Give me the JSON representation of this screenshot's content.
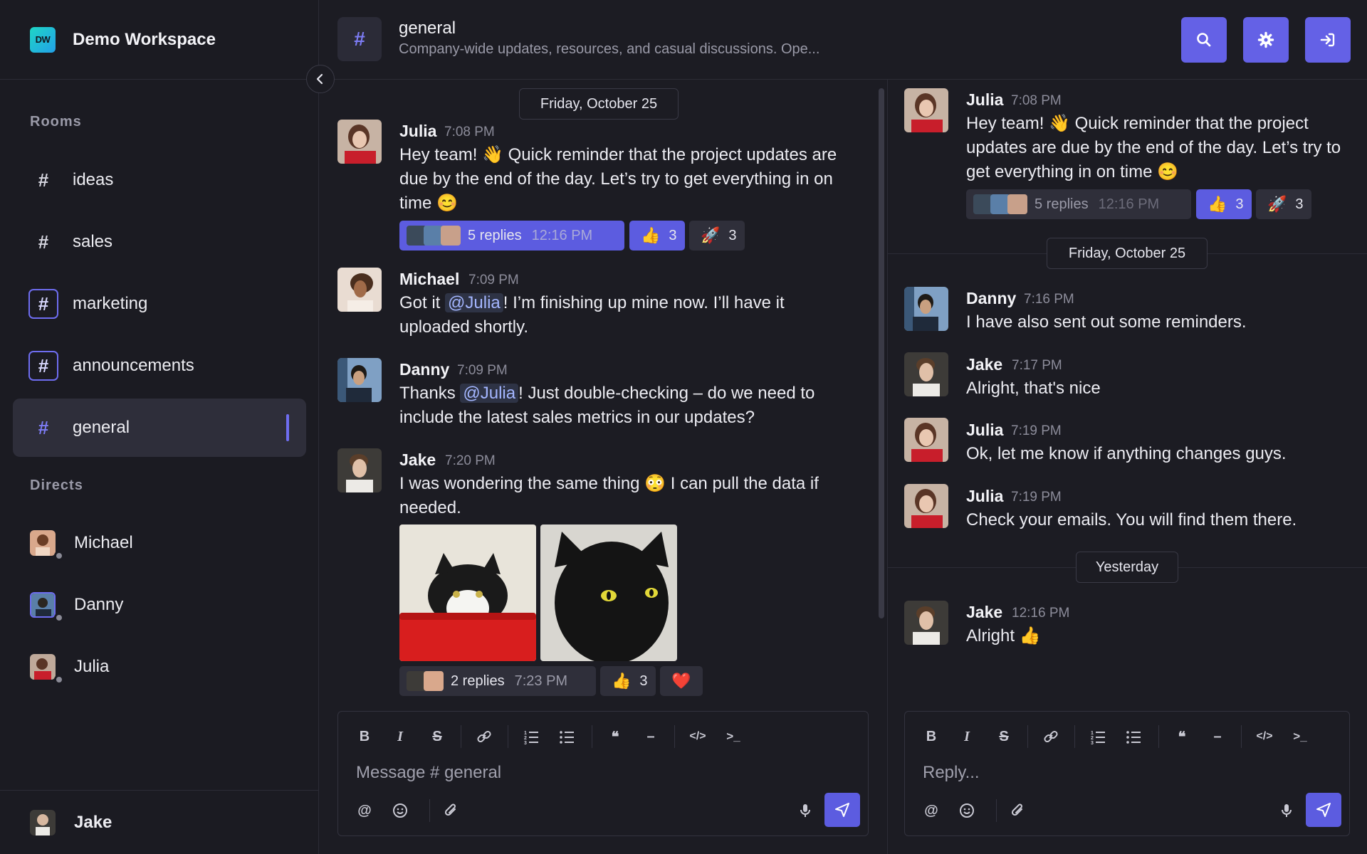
{
  "workspace": {
    "logo_text": "DW",
    "name": "Demo Workspace"
  },
  "sidebar": {
    "rooms_label": "Rooms",
    "rooms": [
      {
        "hash": "#",
        "label": "ideas"
      },
      {
        "hash": "#",
        "label": "sales"
      },
      {
        "hash": "#",
        "label": "marketing"
      },
      {
        "hash": "#",
        "label": "announcements"
      },
      {
        "hash": "#",
        "label": "general",
        "active": true
      }
    ],
    "directs_label": "Directs",
    "directs": [
      {
        "label": "Michael",
        "status": "offline"
      },
      {
        "label": "Danny",
        "status": "offline"
      },
      {
        "label": "Julia",
        "status": "offline"
      }
    ],
    "current_user": "Jake"
  },
  "header": {
    "hash": "#",
    "title": "general",
    "description": "Company-wide updates, resources, and casual discussions. Ope...",
    "buttons": [
      "search-icon",
      "gear-icon",
      "sign-in-icon"
    ]
  },
  "main": {
    "date_divider": "Friday, October 25",
    "messages": [
      {
        "author": "Julia",
        "time": "7:08 PM",
        "text": "Hey team! 👋 Quick reminder that the project updates are due by the end of the day. Let’s try to get everything in on time 😊",
        "replies": {
          "label": "5 replies",
          "time": "12:16 PM"
        },
        "reactions": [
          {
            "emoji": "👍",
            "count": "3",
            "active": true
          },
          {
            "emoji": "🚀",
            "count": "3"
          }
        ]
      },
      {
        "author": "Michael",
        "time": "7:09 PM",
        "text_parts": [
          "Got it ",
          "@Julia",
          "! I’m finishing up mine now. I’ll have it uploaded shortly."
        ]
      },
      {
        "author": "Danny",
        "time": "7:09 PM",
        "text_parts": [
          "Thanks ",
          "@Julia",
          "! Just double-checking – do we need to include the latest sales metrics in our updates?"
        ]
      },
      {
        "author": "Jake",
        "time": "7:20 PM",
        "text": "I was wondering the same thing 😳 I can pull the data if needed.",
        "images": [
          "cat-in-red-bucket",
          "black-cat"
        ],
        "replies": {
          "label": "2 replies",
          "time": "7:23 PM"
        },
        "reactions": [
          {
            "emoji": "👍",
            "count": "3"
          },
          {
            "emoji": "❤️",
            "count": ""
          }
        ]
      }
    ],
    "composer": {
      "placeholder": "Message # general"
    }
  },
  "thread": {
    "root": {
      "author": "Julia",
      "time": "7:08 PM",
      "text": "Hey team! 👋 Quick reminder that the project updates are due by the end of the day. Let’s try to get everything in on time 😊",
      "replies": {
        "label": "5 replies",
        "time": "12:16 PM"
      },
      "reactions": [
        {
          "emoji": "👍",
          "count": "3",
          "active": true
        },
        {
          "emoji": "🚀",
          "count": "3"
        }
      ]
    },
    "divider_1": "Friday, October 25",
    "replies": [
      {
        "author": "Danny",
        "time": "7:16 PM",
        "text": "I have also sent out some reminders."
      },
      {
        "author": "Jake",
        "time": "7:17 PM",
        "text": "Alright, that's nice"
      },
      {
        "author": "Julia",
        "time": "7:19 PM",
        "text": "Ok, let me know if anything changes guys."
      },
      {
        "author": "Julia",
        "time": "7:19 PM",
        "text": "Check your emails. You will find them there."
      }
    ],
    "divider_2": "Yesterday",
    "last": {
      "author": "Jake",
      "time": "12:16 PM",
      "text": "Alright 👍"
    },
    "composer": {
      "placeholder": "Reply..."
    }
  },
  "colors": {
    "accent": "#6461e6",
    "background": "#1c1c23",
    "sidebar": "#1b1b22",
    "mention": "#a4b6ff"
  }
}
